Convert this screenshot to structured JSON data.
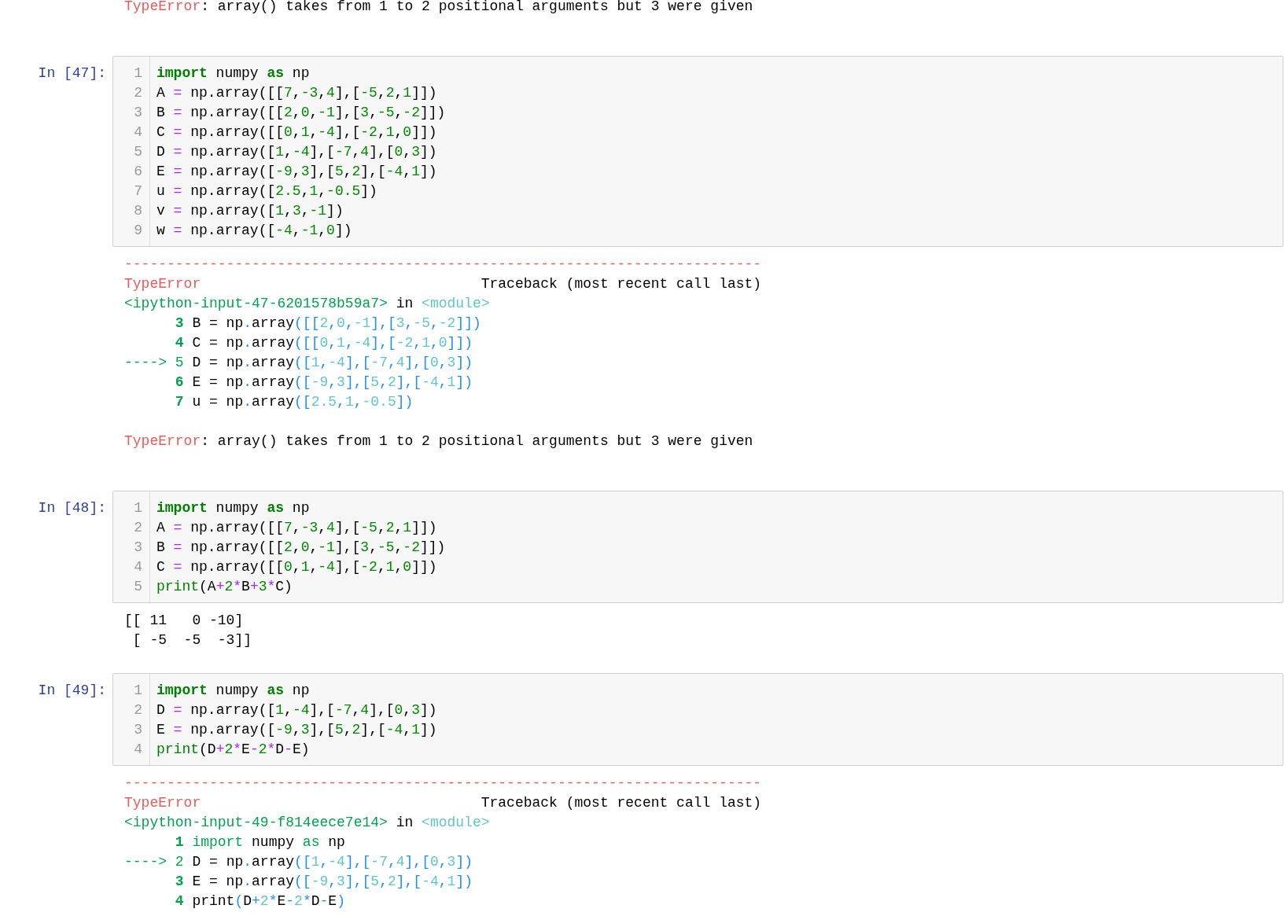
{
  "cells": [
    {
      "output": {
        "kind": "error",
        "lines": [
          {
            "kind": "message",
            "segments": [
              {
                "kind": "error",
                "text": "TypeError"
              },
              {
                "kind": "plain",
                "text": ": array() takes from 1 to 2 positional arguments but 3 were given"
              }
            ]
          }
        ]
      }
    },
    {
      "prompt": "In [47]:",
      "code": [
        {
          "number": "1",
          "segments": [
            {
              "kind": "keyword",
              "text": "import"
            },
            {
              "kind": "code",
              "text": " numpy "
            },
            {
              "kind": "keyword",
              "text": "as"
            },
            {
              "kind": "code",
              "text": " np"
            }
          ]
        },
        {
          "number": "2",
          "segments": [
            {
              "kind": "code",
              "text": "A = np.array([[7,-3,4],[-5,2,1]])"
            }
          ]
        },
        {
          "number": "3",
          "segments": [
            {
              "kind": "code",
              "text": "B = np.array([[2,0,-1],[3,-5,-2]])"
            }
          ]
        },
        {
          "number": "4",
          "segments": [
            {
              "kind": "code",
              "text": "C = np.array([[0,1,-4],[-2,1,0]])"
            }
          ]
        },
        {
          "number": "5",
          "segments": [
            {
              "kind": "code",
              "text": "D = np.array([1,-4],[-7,4],[0,3])"
            }
          ]
        },
        {
          "number": "6",
          "segments": [
            {
              "kind": "code",
              "text": "E = np.array([-9,3],[5,2],[-4,1])"
            }
          ]
        },
        {
          "number": "7",
          "segments": [
            {
              "kind": "code",
              "text": "u = np.array([2.5,1,-0.5])"
            }
          ]
        },
        {
          "number": "8",
          "segments": [
            {
              "kind": "code",
              "text": "v = np.array([1,3,-1])"
            }
          ]
        },
        {
          "number": "9",
          "segments": [
            {
              "kind": "code",
              "text": "w = np.array([-4,-1,0])"
            }
          ]
        }
      ],
      "output": {
        "kind": "error",
        "lines": [
          {
            "kind": "rule",
            "segments": [
              {
                "kind": "error",
                "text": "---------------------------------------------------------------------------"
              }
            ]
          },
          {
            "kind": "frame",
            "segments": [
              {
                "kind": "error",
                "text": "TypeError"
              },
              {
                "kind": "plain",
                "text": "                                 Traceback (most recent call last)"
              }
            ]
          },
          {
            "kind": "frame",
            "segments": [
              {
                "kind": "green",
                "text": "<ipython-input-47-6201578b59a7>"
              },
              {
                "kind": "plain",
                "text": " in "
              },
              {
                "kind": "cyan",
                "text": "<module>"
              }
            ]
          },
          {
            "kind": "frame",
            "segments": [
              {
                "kind": "lineno",
                "text": "3"
              },
              {
                "kind": "plain",
                "text": " B = np"
              },
              {
                "kind": "args",
                "text": "."
              },
              {
                "kind": "plain",
                "text": "array"
              },
              {
                "kind": "args",
                "text": "([[2,0,-1],[3,-5,-2]])"
              }
            ]
          },
          {
            "kind": "frame",
            "segments": [
              {
                "kind": "lineno",
                "text": "4"
              },
              {
                "kind": "plain",
                "text": " C = np"
              },
              {
                "kind": "args",
                "text": "."
              },
              {
                "kind": "plain",
                "text": "array"
              },
              {
                "kind": "args",
                "text": "([[0,1,-4],[-2,1,0]])"
              }
            ]
          },
          {
            "kind": "frame",
            "segments": [
              {
                "kind": "green",
                "text": "----> 5"
              },
              {
                "kind": "plain",
                "text": " D = np"
              },
              {
                "kind": "args",
                "text": "."
              },
              {
                "kind": "plain",
                "text": "array"
              },
              {
                "kind": "args",
                "text": "([1,-4],[-7,4],[0,3])"
              }
            ]
          },
          {
            "kind": "frame",
            "segments": [
              {
                "kind": "lineno",
                "text": "6"
              },
              {
                "kind": "plain",
                "text": " E = np"
              },
              {
                "kind": "args",
                "text": "."
              },
              {
                "kind": "plain",
                "text": "array"
              },
              {
                "kind": "args",
                "text": "([-9,3],[5,2],[-4,1])"
              }
            ]
          },
          {
            "kind": "frame",
            "segments": [
              {
                "kind": "lineno",
                "text": "7"
              },
              {
                "kind": "plain",
                "text": " u = np"
              },
              {
                "kind": "args",
                "text": "."
              },
              {
                "kind": "plain",
                "text": "array"
              },
              {
                "kind": "args",
                "text": "([2.5,1,-0.5])"
              }
            ]
          },
          {
            "kind": "message",
            "segments": [
              {
                "kind": "error",
                "text": "TypeError"
              },
              {
                "kind": "plain",
                "text": ": array() takes from 1 to 2 positional arguments but 3 were given"
              }
            ]
          }
        ]
      }
    },
    {
      "prompt": "In [48]:",
      "code": [
        {
          "number": "1",
          "segments": [
            {
              "kind": "keyword",
              "text": "import"
            },
            {
              "kind": "code",
              "text": " numpy "
            },
            {
              "kind": "keyword",
              "text": "as"
            },
            {
              "kind": "code",
              "text": " np"
            }
          ]
        },
        {
          "number": "2",
          "segments": [
            {
              "kind": "code",
              "text": "A = np.array([[7,-3,4],[-5,2,1]])"
            }
          ]
        },
        {
          "number": "3",
          "segments": [
            {
              "kind": "code",
              "text": "B = np.array([[2,0,-1],[3,-5,-2]])"
            }
          ]
        },
        {
          "number": "4",
          "segments": [
            {
              "kind": "code",
              "text": "C = np.array([[0,1,-4],[-2,1,0]])"
            }
          ]
        },
        {
          "number": "5",
          "segments": [
            {
              "kind": "builtin",
              "text": "print"
            },
            {
              "kind": "code",
              "text": "(A+2*B+3*C)"
            }
          ]
        }
      ],
      "output": {
        "kind": "stream",
        "lines": [
          {
            "kind": "text",
            "segments": [
              {
                "kind": "plain",
                "text": "[[ 11   0 -10]"
              }
            ]
          },
          {
            "kind": "text",
            "segments": [
              {
                "kind": "plain",
                "text": " [ -5  -5  -3]]"
              }
            ]
          }
        ]
      }
    },
    {
      "prompt": "In [49]:",
      "code": [
        {
          "number": "1",
          "segments": [
            {
              "kind": "keyword",
              "text": "import"
            },
            {
              "kind": "code",
              "text": " numpy "
            },
            {
              "kind": "keyword",
              "text": "as"
            },
            {
              "kind": "code",
              "text": " np"
            }
          ]
        },
        {
          "number": "2",
          "segments": [
            {
              "kind": "code",
              "text": "D = np.array([1,-4],[-7,4],[0,3])"
            }
          ]
        },
        {
          "number": "3",
          "segments": [
            {
              "kind": "code",
              "text": "E = np.array([-9,3],[5,2],[-4,1])"
            }
          ]
        },
        {
          "number": "4",
          "segments": [
            {
              "kind": "builtin",
              "text": "print"
            },
            {
              "kind": "code",
              "text": "(D+2*E-2*D-E)"
            }
          ]
        }
      ],
      "output": {
        "kind": "error",
        "lines": [
          {
            "kind": "rule",
            "segments": [
              {
                "kind": "error",
                "text": "---------------------------------------------------------------------------"
              }
            ]
          },
          {
            "kind": "frame",
            "segments": [
              {
                "kind": "error",
                "text": "TypeError"
              },
              {
                "kind": "plain",
                "text": "                                 Traceback (most recent call last)"
              }
            ]
          },
          {
            "kind": "frame",
            "segments": [
              {
                "kind": "green",
                "text": "<ipython-input-49-f814eece7e14>"
              },
              {
                "kind": "plain",
                "text": " in "
              },
              {
                "kind": "cyan",
                "text": "<module>"
              }
            ]
          },
          {
            "kind": "frame",
            "segments": [
              {
                "kind": "lineno",
                "text": "1"
              },
              {
                "kind": "green",
                "text": " import"
              },
              {
                "kind": "plain",
                "text": " numpy "
              },
              {
                "kind": "green",
                "text": "as"
              },
              {
                "kind": "plain",
                "text": " np"
              }
            ]
          },
          {
            "kind": "frame",
            "segments": [
              {
                "kind": "green",
                "text": "----> 2"
              },
              {
                "kind": "plain",
                "text": " D = np"
              },
              {
                "kind": "args",
                "text": "."
              },
              {
                "kind": "plain",
                "text": "array"
              },
              {
                "kind": "args",
                "text": "([1,-4],[-7,4],[0,3])"
              }
            ]
          },
          {
            "kind": "frame",
            "segments": [
              {
                "kind": "lineno",
                "text": "3"
              },
              {
                "kind": "plain",
                "text": " E = np"
              },
              {
                "kind": "args",
                "text": "."
              },
              {
                "kind": "plain",
                "text": "array"
              },
              {
                "kind": "args",
                "text": "([-9,3],[5,2],[-4,1])"
              }
            ]
          },
          {
            "kind": "frame",
            "segments": [
              {
                "kind": "lineno",
                "text": "4"
              },
              {
                "kind": "plain",
                "text": " print"
              },
              {
                "kind": "args",
                "text": "("
              },
              {
                "kind": "plain",
                "text": "D"
              },
              {
                "kind": "args",
                "text": "+2*"
              },
              {
                "kind": "plain",
                "text": "E"
              },
              {
                "kind": "args",
                "text": "-2*"
              },
              {
                "kind": "plain",
                "text": "D"
              },
              {
                "kind": "args",
                "text": "-"
              },
              {
                "kind": "plain",
                "text": "E"
              },
              {
                "kind": "args",
                "text": ")"
              }
            ]
          }
        ]
      }
    }
  ]
}
